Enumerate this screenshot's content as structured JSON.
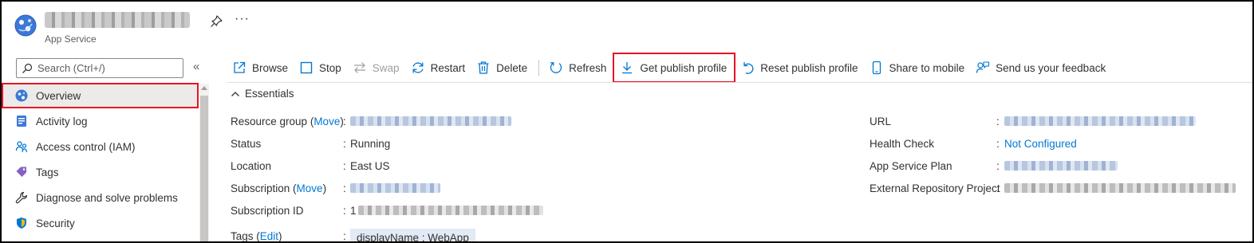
{
  "header": {
    "resource_type": "App Service",
    "more_label": "···"
  },
  "sidebar": {
    "search_placeholder": "Search (Ctrl+/)",
    "collapse_label": "«",
    "items": [
      {
        "label": "Overview",
        "icon": "app-service-icon",
        "selected": true
      },
      {
        "label": "Activity log",
        "icon": "activity-log-icon"
      },
      {
        "label": "Access control (IAM)",
        "icon": "iam-icon"
      },
      {
        "label": "Tags",
        "icon": "tag-icon"
      },
      {
        "label": "Diagnose and solve problems",
        "icon": "wrench-icon"
      },
      {
        "label": "Security",
        "icon": "shield-icon"
      }
    ]
  },
  "toolbar": {
    "browse": "Browse",
    "stop": "Stop",
    "swap": "Swap",
    "restart": "Restart",
    "delete": "Delete",
    "refresh": "Refresh",
    "get_publish_profile": "Get publish profile",
    "reset_publish_profile": "Reset publish profile",
    "share_to_mobile": "Share to mobile",
    "feedback": "Send us your feedback"
  },
  "essentials": {
    "title": "Essentials",
    "left": {
      "resource_group_label": "Resource group",
      "move_link": "Move",
      "status_label": "Status",
      "status_value": "Running",
      "location_label": "Location",
      "location_value": "East US",
      "subscription_label": "Subscription",
      "subscription_id_label": "Subscription ID",
      "subscription_id_prefix": "1",
      "tags_label": "Tags",
      "edit_link": "Edit",
      "tag_value": "displayName : WebApp"
    },
    "right": {
      "url_label": "URL",
      "health_check_label": "Health Check",
      "health_check_value": "Not Configured",
      "app_service_plan_label": "App Service Plan",
      "external_repo_label": "External Repository Project"
    },
    "colon": ":"
  },
  "colors": {
    "accent": "#0078d4",
    "highlight_border": "#e81123",
    "selected_bg": "#edebe9"
  }
}
